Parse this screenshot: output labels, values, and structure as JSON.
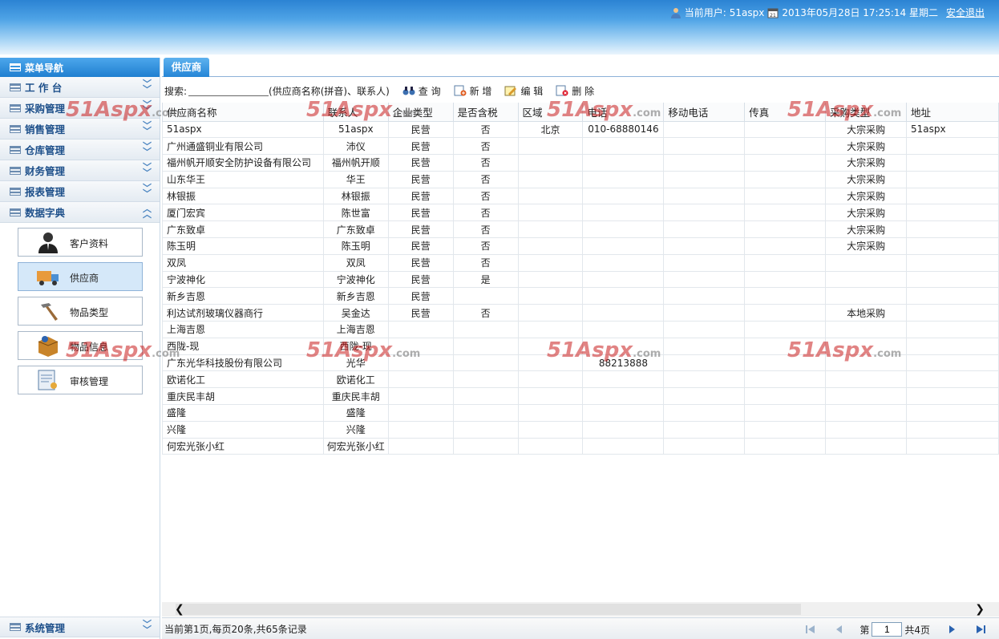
{
  "header": {
    "user_label": "当前用户:",
    "user_name": "51aspx",
    "datetime": "2013年05月28日 17:25:14 星期二",
    "logout": "安全退出"
  },
  "sidebar": {
    "title": "菜单导航",
    "sections": [
      {
        "label": "工 作 台",
        "icon": "chevron-down-icon"
      },
      {
        "label": "采购管理",
        "icon": "chevron-down-icon"
      },
      {
        "label": "销售管理",
        "icon": "chevron-down-icon"
      },
      {
        "label": "仓库管理",
        "icon": "chevron-down-icon"
      },
      {
        "label": "财务管理",
        "icon": "chevron-down-icon"
      },
      {
        "label": "报表管理",
        "icon": "chevron-down-icon"
      },
      {
        "label": "数据字典",
        "icon": "chevron-up-icon"
      }
    ],
    "items": [
      {
        "label": "客户资料",
        "icon": "person-icon"
      },
      {
        "label": "供应商",
        "icon": "truck-icon"
      },
      {
        "label": "物品类型",
        "icon": "hammer-icon"
      },
      {
        "label": "物品信息",
        "icon": "box-icon"
      },
      {
        "label": "审核管理",
        "icon": "document-key-icon"
      }
    ],
    "bottom": {
      "label": "系统管理",
      "icon": "chevron-down-icon"
    }
  },
  "tab": {
    "label": "供应商"
  },
  "toolbar": {
    "search_label": "搜索:",
    "search_value": "",
    "search_hint": "(供应商名称(拼音)、联系人)",
    "query": "查 询",
    "add": "新 增",
    "edit": "编 辑",
    "delete": "删 除"
  },
  "table": {
    "columns": [
      "供应商名称",
      "联系人",
      "企业类型",
      "是否含税",
      "区域",
      "电话",
      "移动电话",
      "传真",
      "采购类型",
      "地址"
    ],
    "rows": [
      [
        "51aspx",
        "51aspx",
        "民营",
        "否",
        "北京",
        "010-68880146",
        "",
        "",
        "大宗采购",
        "51aspx"
      ],
      [
        "广州通盛铜业有限公司",
        "沛仪",
        "民营",
        "否",
        "",
        "",
        "",
        "",
        "大宗采购",
        ""
      ],
      [
        "福州帆开顺安全防护设备有限公司",
        "福州帆开顺",
        "民营",
        "否",
        "",
        "",
        "",
        "",
        "大宗采购",
        ""
      ],
      [
        "山东华王",
        "华王",
        "民营",
        "否",
        "",
        "",
        "",
        "",
        "大宗采购",
        ""
      ],
      [
        "林银振",
        "林银振",
        "民营",
        "否",
        "",
        "",
        "",
        "",
        "大宗采购",
        ""
      ],
      [
        "厦门宏宾",
        "陈世富",
        "民营",
        "否",
        "",
        "",
        "",
        "",
        "大宗采购",
        ""
      ],
      [
        "广东致卓",
        "广东致卓",
        "民营",
        "否",
        "",
        "",
        "",
        "",
        "大宗采购",
        ""
      ],
      [
        "陈玉明",
        "陈玉明",
        "民营",
        "否",
        "",
        "",
        "",
        "",
        "大宗采购",
        ""
      ],
      [
        "双凤",
        "双凤",
        "民营",
        "否",
        "",
        "",
        "",
        "",
        "",
        ""
      ],
      [
        "宁波神化",
        "宁波神化",
        "民营",
        "是",
        "",
        "",
        "",
        "",
        "",
        ""
      ],
      [
        "新乡吉恩",
        "新乡吉恩",
        "民营",
        "",
        "",
        "",
        "",
        "",
        "",
        ""
      ],
      [
        "利达试剂玻璃仪器商行",
        "吴金达",
        "民营",
        "否",
        "",
        "",
        "",
        "",
        "本地采购",
        ""
      ],
      [
        "上海吉恩",
        "上海吉恩",
        "",
        "",
        "",
        "",
        "",
        "",
        "",
        ""
      ],
      [
        "西陇-现",
        "西陇-现",
        "",
        "",
        "",
        "",
        "",
        "",
        "",
        ""
      ],
      [
        "广东光华科技股份有限公司",
        "光华",
        "",
        "",
        "",
        "88213888",
        "",
        "",
        "",
        ""
      ],
      [
        "欧诺化工",
        "欧诺化工",
        "",
        "",
        "",
        "",
        "",
        "",
        "",
        ""
      ],
      [
        "重庆民丰胡",
        "重庆民丰胡",
        "",
        "",
        "",
        "",
        "",
        "",
        "",
        ""
      ],
      [
        "盛隆",
        "盛隆",
        "",
        "",
        "",
        "",
        "",
        "",
        "",
        ""
      ],
      [
        "兴隆",
        "兴隆",
        "",
        "",
        "",
        "",
        "",
        "",
        "",
        ""
      ],
      [
        "何宏光张小红",
        "何宏光张小红",
        "",
        "",
        "",
        "",
        "",
        "",
        "",
        ""
      ]
    ]
  },
  "pager": {
    "info": "当前第1页,每页20条,共65条记录",
    "page_prefix": "第",
    "page_value": "1",
    "page_total": "共4页"
  },
  "watermark": {
    "text": "51Aspx",
    "suffix": ".com"
  }
}
